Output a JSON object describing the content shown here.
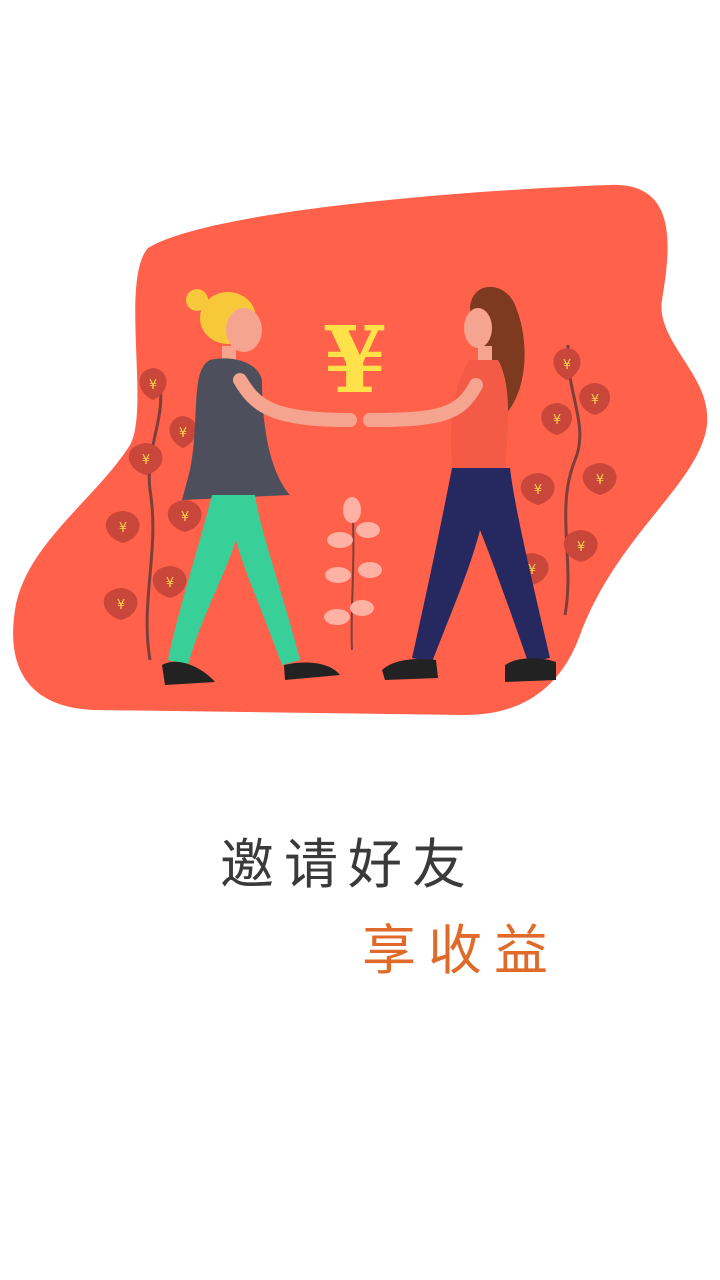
{
  "splash": {
    "illustration": {
      "currency_symbol": "¥",
      "colors": {
        "background_blob": "#ff614a",
        "coin": "#ffe14a",
        "leaf": "#c8463a",
        "leaf_symbol": "#f6d34a",
        "left_person_shirt": "#4d4f5c",
        "left_person_pants": "#39cf98",
        "right_person_shirt": "#f35b47",
        "right_person_pants": "#26295f",
        "shoe": "#222222"
      }
    },
    "headline": "邀请好友",
    "subline": "享收益",
    "colors": {
      "headline": "#3a3a3a",
      "subline": "#e06a2a",
      "page_background": "#ffffff"
    }
  }
}
